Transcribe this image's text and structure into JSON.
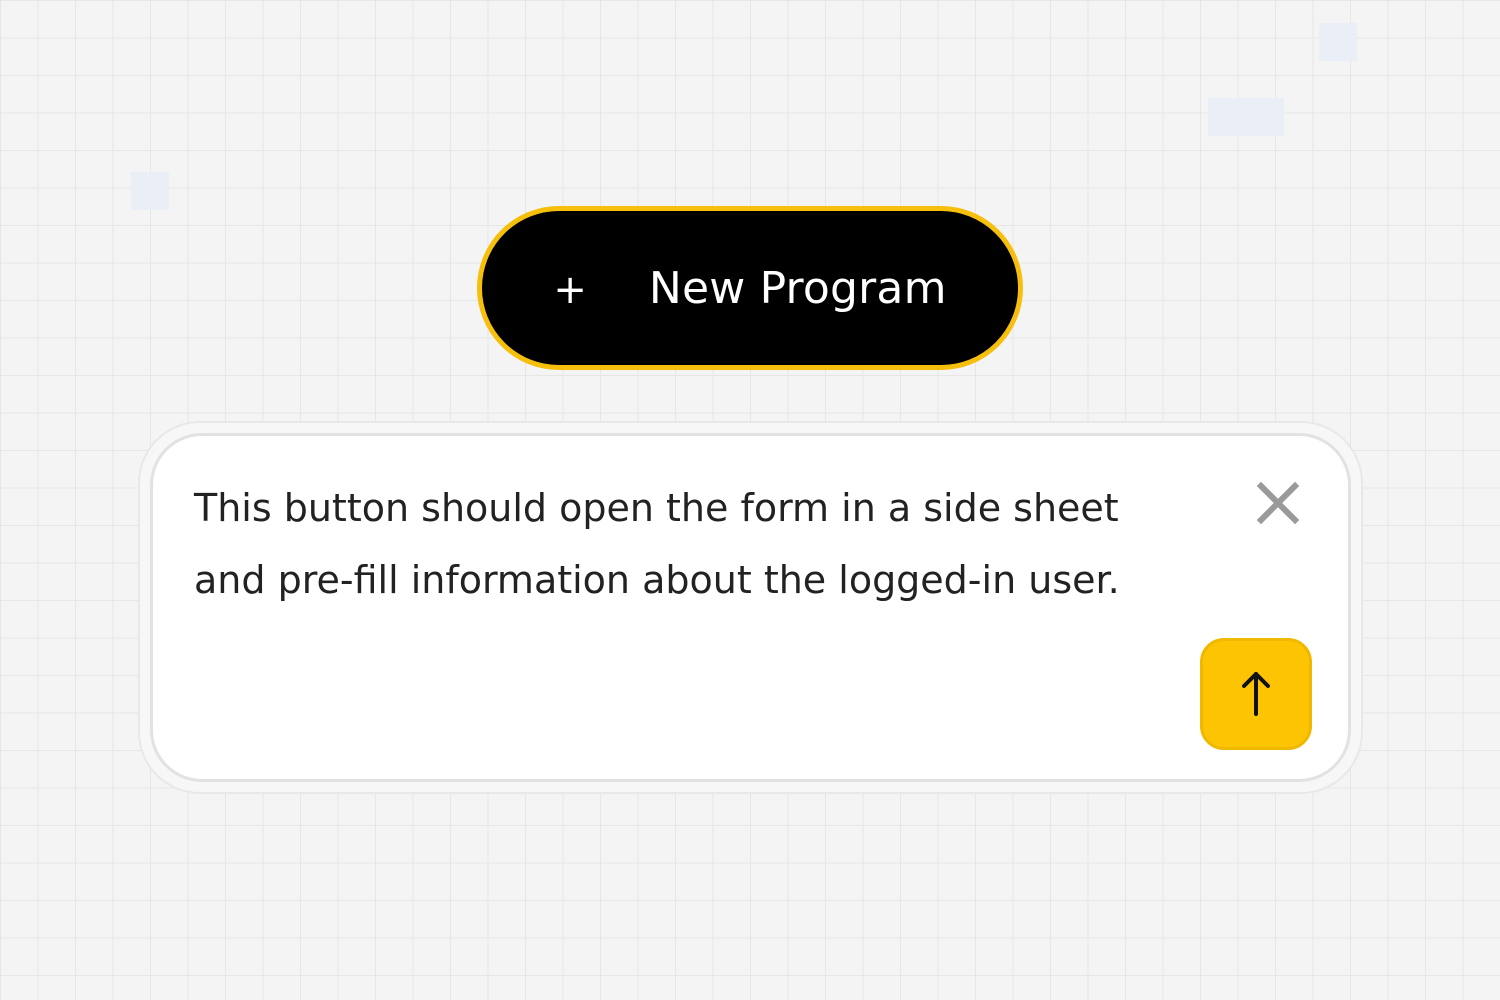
{
  "button": {
    "icon": "plus-icon",
    "plus_glyph": "+",
    "label": "New Program",
    "background": "#000000",
    "border": "#f5bf0c"
  },
  "comment": {
    "text": "This button should open the form in a side sheet and pre-fill information about the logged-in user.",
    "close_icon": "close-icon",
    "submit_icon": "arrow-up-icon",
    "submit_color": "#fdc404"
  }
}
